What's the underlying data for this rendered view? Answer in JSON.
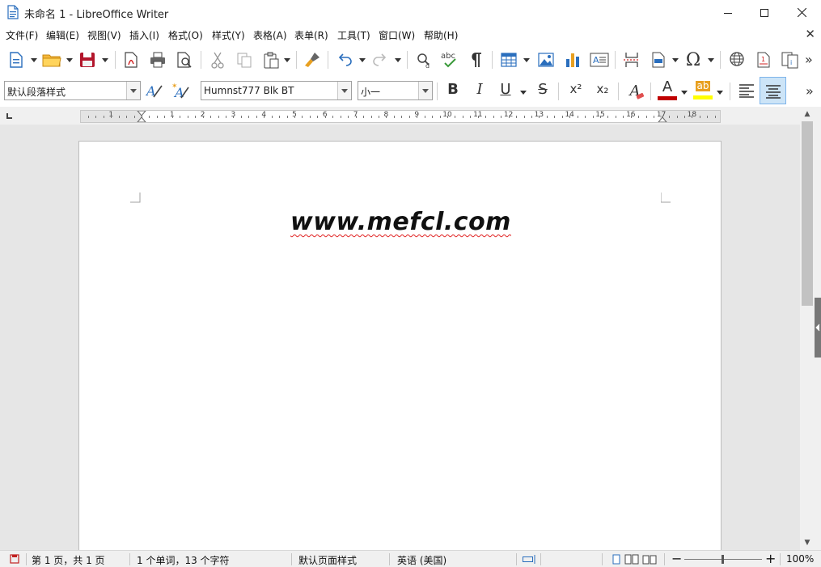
{
  "window": {
    "title": "未命名 1 - LibreOffice Writer"
  },
  "menu": {
    "items": [
      "文件(F)",
      "编辑(E)",
      "视图(V)",
      "插入(I)",
      "格式(O)",
      "样式(Y)",
      "表格(A)",
      "表单(R)",
      "工具(T)",
      "窗口(W)",
      "帮助(H)"
    ]
  },
  "format_toolbar": {
    "paragraph_style": "默认段落样式",
    "font_name": "Humnst777 Blk BT",
    "font_size": "小一",
    "bold": "B",
    "italic": "I",
    "underline": "U",
    "strike": "S",
    "superscript": "x²",
    "subscript": "x₂",
    "clear_format": "A",
    "font_color_letter": "A",
    "highlight_letter": "ab",
    "font_color": "#c00000",
    "highlight_color": "#ffff00"
  },
  "ruler": {
    "numbers": [
      "1",
      "1",
      "2",
      "3",
      "4",
      "5",
      "6",
      "7",
      "8",
      "9",
      "10",
      "11",
      "12",
      "13",
      "14",
      "15",
      "16",
      "17",
      "18"
    ]
  },
  "document": {
    "text": "www.mefcl.com"
  },
  "status": {
    "page": "第 1 页，共 1 页",
    "words": "1 个单词，13 个字符",
    "page_style": "默认页面样式",
    "language": "英语 (美国)",
    "zoom": "100%"
  },
  "colors": {
    "accent": "#2a6ebd",
    "spellcheck": "#e02020"
  }
}
